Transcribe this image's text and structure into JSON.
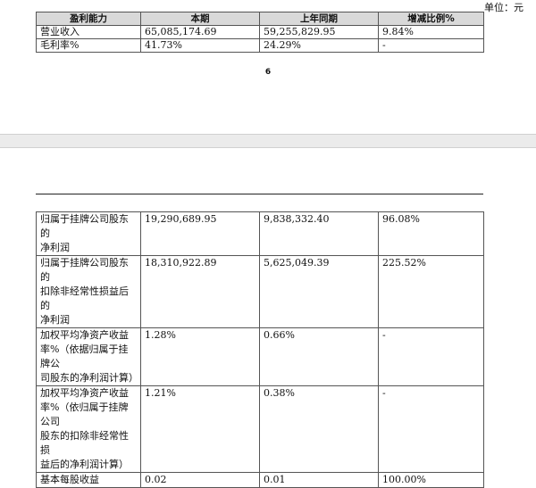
{
  "unit_label": "单位：元",
  "page_number": "6",
  "profitability_table": {
    "headers": [
      "盈利能力",
      "本期",
      "上年同期",
      "增减比例%"
    ],
    "rows": [
      [
        "营业收入",
        "65,085,174.69",
        "59,255,829.95",
        "9.84%"
      ],
      [
        "毛利率%",
        "41.73%",
        "24.29%",
        "-"
      ]
    ]
  },
  "continuation_table": {
    "rows": [
      {
        "label_lines": [
          "归属于挂牌公司股东的",
          "净利润"
        ],
        "current": "19,290,689.95",
        "previous": "9,838,332.40",
        "change": "96.08%"
      },
      {
        "label_lines": [
          "归属于挂牌公司股东的",
          "扣除非经常性损益后的",
          "净利润"
        ],
        "current": "18,310,922.89",
        "previous": "5,625,049.39",
        "change": "225.52%"
      },
      {
        "label_lines": [
          "加权平均净资产收益",
          "率%（依据归属于挂牌公",
          "司股东的净利润计算）"
        ],
        "current": "1.28%",
        "previous": "0.66%",
        "change": "-"
      },
      {
        "label_lines": [
          "加权平均净资产收益",
          "率%（依归属于挂牌公司",
          "股东的扣除非经常性损",
          "益后的净利润计算）"
        ],
        "current": "1.21%",
        "previous": "0.38%",
        "change": "-"
      },
      {
        "label_lines": [
          "基本每股收益"
        ],
        "current": "0.02",
        "previous": "0.01",
        "change": "100.00%"
      }
    ]
  }
}
